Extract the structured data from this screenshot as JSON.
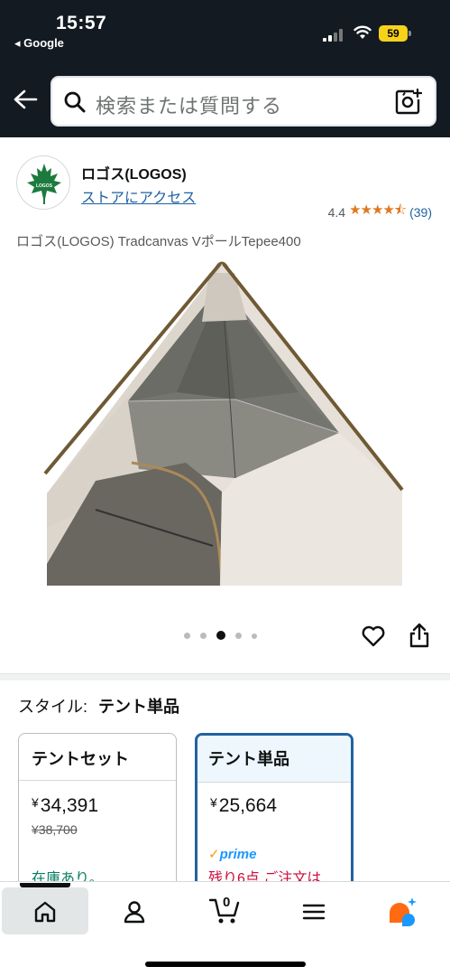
{
  "status_bar": {
    "time": "15:57",
    "back_app": "◂ Google",
    "battery": "59"
  },
  "search": {
    "placeholder": "検索または質問する"
  },
  "store": {
    "name": "ロゴス(LOGOS)",
    "link": "ストアにアクセス",
    "rating_value": "4.4",
    "rating_stars": "★★★★⯪",
    "rating_count": "(39)",
    "logo_text": "LOGOS"
  },
  "product": {
    "title": "ロゴス(LOGOS) Tradcanvas VポールTepee400",
    "image_count": 5,
    "active_image": 3
  },
  "style": {
    "label": "スタイル:",
    "selected": "テント単品"
  },
  "options": [
    {
      "name": "テントセット",
      "currency": "¥",
      "price": "34,391",
      "old_price": "¥38,700",
      "stock": "在庫あり。"
    },
    {
      "name": "テント単品",
      "currency": "¥",
      "price": "25,664",
      "prime": "prime",
      "availability": "残り6点 ご注文は"
    }
  ],
  "nav": {
    "cart_count": "0"
  },
  "colors": {
    "header_bg": "#131a22",
    "link": "#2162a1",
    "star": "#de7921",
    "in_stock": "#067d62",
    "low_stock": "#cc0c39",
    "prime": "#1a98ff"
  }
}
